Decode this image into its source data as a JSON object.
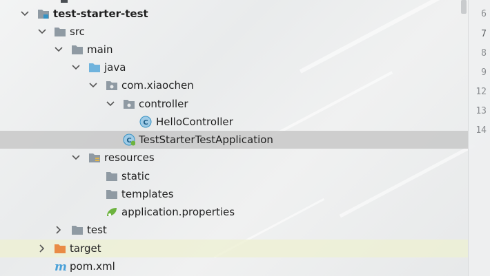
{
  "tree": {
    "root_label": "test-starter-test",
    "items": [
      {
        "label": "src"
      },
      {
        "label": "main"
      },
      {
        "label": "java"
      },
      {
        "label": "com.xiaochen"
      },
      {
        "label": "controller"
      },
      {
        "label": "HelloController"
      },
      {
        "label": "TestStarterTestApplication"
      },
      {
        "label": "resources"
      },
      {
        "label": "static"
      },
      {
        "label": "templates"
      },
      {
        "label": "application.properties"
      },
      {
        "label": "test"
      },
      {
        "label": "target"
      },
      {
        "label": "pom.xml"
      }
    ],
    "selected_item": "TestStarterTestApplication"
  },
  "gutter": {
    "line_numbers": [
      "6",
      "7",
      "8",
      "9",
      "12",
      "13",
      "14"
    ]
  },
  "colors": {
    "folder_gray": "#8f9aa3",
    "source_folder_blue": "#6fb3dd",
    "excluded_folder_orange": "#e98b46",
    "class_icon_blue": "#3592c4",
    "selection_bg": "#c8c8c8",
    "highlight_bg": "#eef0d2",
    "maven_m": "#4aa0d8"
  },
  "icons": {
    "chevron_down": "chevron-down-icon",
    "chevron_right": "chevron-right-icon",
    "folder": "folder-icon",
    "package": "package-folder-icon",
    "class": "java-class-icon",
    "spring": "spring-leaf-icon",
    "maven": "maven-icon"
  }
}
